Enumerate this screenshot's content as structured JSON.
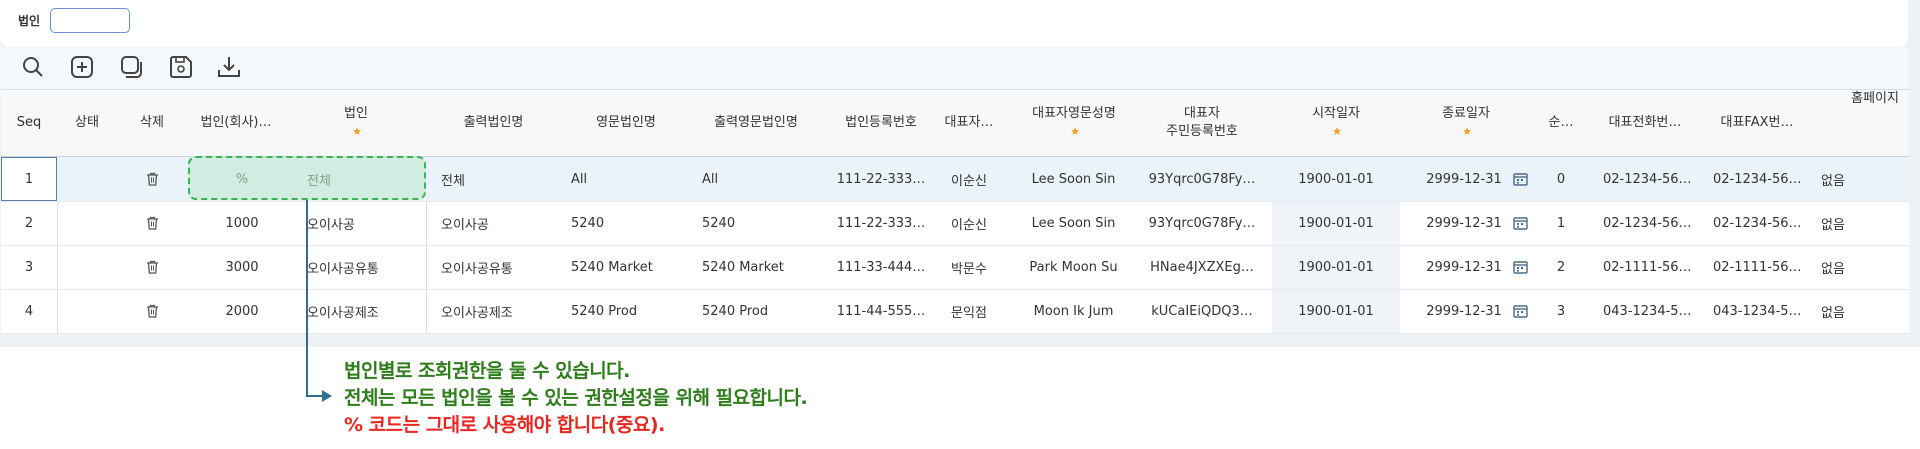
{
  "filter": {
    "label": "법인",
    "value": ""
  },
  "toolbar": {
    "icons": [
      "search-icon",
      "add-icon",
      "copy-icon",
      "save-icon",
      "download-icon"
    ]
  },
  "columns": [
    "Seq",
    "상태",
    "삭제",
    "법인(회사)…",
    "법인",
    "출력법인명",
    "영문법인명",
    "출력영문법인명",
    "법인등록번호",
    "대표자…",
    "대표자영문성명",
    "대표자\n주민등록번호",
    "시작일자",
    "종료일자",
    "",
    "순…",
    "대표전화번…",
    "대표FAX번…",
    "홈페이지"
  ],
  "required": [
    "법인",
    "대표자영문성명",
    "시작일자",
    "종료일자"
  ],
  "rows": [
    {
      "seq": "1",
      "code": "%",
      "name": "전체",
      "print_name": "전체",
      "eng": "All",
      "print_eng": "All",
      "regno": "111-22-333…",
      "rep": "이순신",
      "rep_eng": "Lee Soon Sin",
      "rrn": "93Yqrc0G78Fy…",
      "start": "1900-01-01",
      "end": "2999-12-31",
      "order": "0",
      "tel": "02-1234-56…",
      "fax": "02-1234-56…",
      "home": "없음"
    },
    {
      "seq": "2",
      "code": "1000",
      "name": "오이사공",
      "print_name": "오이사공",
      "eng": "5240",
      "print_eng": "5240",
      "regno": "111-22-333…",
      "rep": "이순신",
      "rep_eng": "Lee Soon Sin",
      "rrn": "93Yqrc0G78Fy…",
      "start": "1900-01-01",
      "end": "2999-12-31",
      "order": "1",
      "tel": "02-1234-56…",
      "fax": "02-1234-56…",
      "home": "없음"
    },
    {
      "seq": "3",
      "code": "3000",
      "name": "오이사공유통",
      "print_name": "오이사공유통",
      "eng": "5240 Market",
      "print_eng": "5240 Market",
      "regno": "111-33-444…",
      "rep": "박문수",
      "rep_eng": "Park Moon Su",
      "rrn": "HNae4JXZXEg…",
      "start": "1900-01-01",
      "end": "2999-12-31",
      "order": "2",
      "tel": "02-1111-56…",
      "fax": "02-1111-56…",
      "home": "없음"
    },
    {
      "seq": "4",
      "code": "2000",
      "name": "오이사공제조",
      "print_name": "오이사공제조",
      "eng": "5240 Prod",
      "print_eng": "5240 Prod",
      "regno": "111-44-555…",
      "rep": "문익점",
      "rep_eng": "Moon Ik Jum",
      "rrn": "kUCaIEiQDQ3…",
      "start": "1900-01-01",
      "end": "2999-12-31",
      "order": "3",
      "tel": "043-1234-5…",
      "fax": "043-1234-5…",
      "home": "없음"
    }
  ],
  "notes": {
    "line1": "법인별로 조회권한을 둘 수 있습니다.",
    "line2": "전체는 모든 법인을 볼 수 있는 권한설정을 위해 필요합니다.",
    "line3": "% 코드는 그대로 사용해야 합니다(중요)."
  },
  "colors": {
    "note_green": "#2e7d1b",
    "note_red": "#e8261f",
    "highlight": "#3db155",
    "connector": "#2d6f8e"
  }
}
